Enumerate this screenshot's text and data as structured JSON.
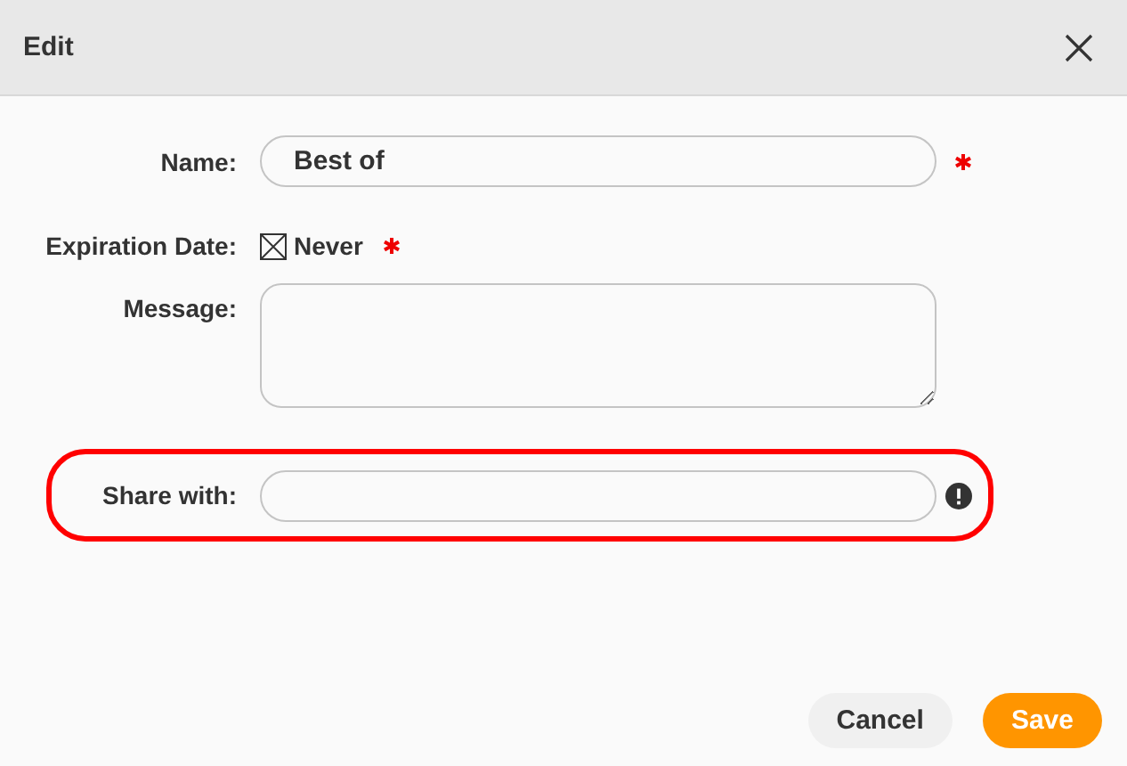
{
  "window": {
    "title": "Edit"
  },
  "fields": [
    {
      "kind": "text",
      "label": "Name:",
      "value": "Best of",
      "required": true,
      "highlighted": false,
      "alert": false
    },
    {
      "kind": "checkbox",
      "label": "Expiration Date:",
      "option": "Never",
      "checked": true,
      "required": true,
      "highlighted": false,
      "alert": false
    },
    {
      "kind": "textarea",
      "label": "Message:",
      "required": false,
      "highlighted": false,
      "alert": false
    },
    {
      "kind": "text",
      "label": "Share with:",
      "required": false,
      "highlighted": true,
      "alert": true
    }
  ],
  "buttons": [
    {
      "label": "Cancel",
      "kind": "secondary"
    },
    {
      "label": "Save",
      "kind": "primary"
    }
  ]
}
